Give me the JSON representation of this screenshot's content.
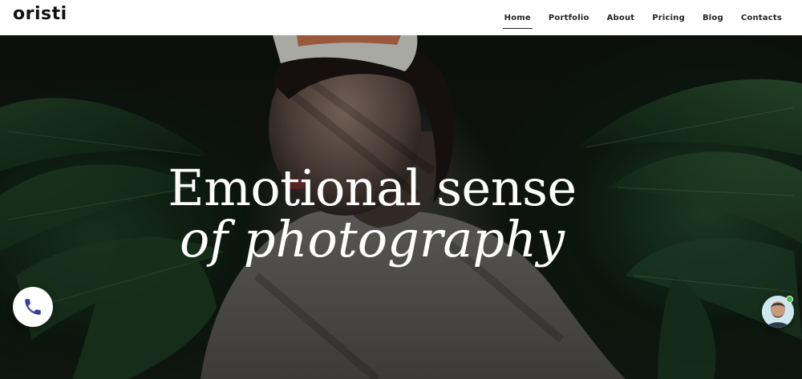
{
  "brand": {
    "logo_text": "oristi"
  },
  "nav": {
    "items": [
      {
        "label": "Home",
        "active": true
      },
      {
        "label": "Portfolio",
        "active": false
      },
      {
        "label": "About",
        "active": false
      },
      {
        "label": "Pricing",
        "active": false
      },
      {
        "label": "Blog",
        "active": false
      },
      {
        "label": "Contacts",
        "active": false
      }
    ]
  },
  "hero": {
    "headline_line1": "Emotional sense",
    "headline_line2": "of photography",
    "image_subject": "woman-in-sweater-with-palm-leaves-shadows"
  },
  "floating": {
    "call_icon": "phone-icon",
    "chat_icon": "support-avatar-icon",
    "chat_status": "online"
  },
  "colors": {
    "header_bg": "#ffffff",
    "text_dark": "#222222",
    "headline": "#ffffff",
    "call_icon": "#3a3f9c",
    "online": "#3cc24a"
  }
}
